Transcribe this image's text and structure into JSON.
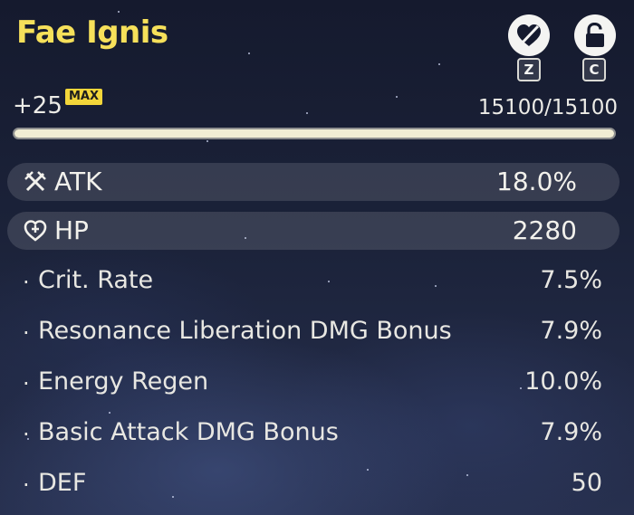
{
  "echo": {
    "name": "Fae Ignis",
    "level": "+25",
    "max_badge": "MAX",
    "exp_text": "15100/15100",
    "exp_fraction": 1.0
  },
  "actions": {
    "discard_hotkey": "Z",
    "lock_hotkey": "C",
    "discard_icon": "heart-slash-icon",
    "lock_icon": "unlocked-padlock-icon"
  },
  "main_stats": [
    {
      "icon": "crossed-swords-icon",
      "name": "ATK",
      "value": "18.0%"
    },
    {
      "icon": "heart-plus-icon",
      "name": "HP",
      "value": "2280"
    }
  ],
  "sub_stats": [
    {
      "name": "Crit. Rate",
      "value": "7.5%"
    },
    {
      "name": "Resonance Liberation DMG Bonus",
      "value": "7.9%"
    },
    {
      "name": "Energy Regen",
      "value": "10.0%"
    },
    {
      "name": "Basic Attack DMG Bonus",
      "value": "7.9%"
    },
    {
      "name": "DEF",
      "value": "50"
    }
  ],
  "colors": {
    "title": "#f6e05a",
    "max_badge": "#f3d63a",
    "bar_fill": "#f2eed4"
  }
}
